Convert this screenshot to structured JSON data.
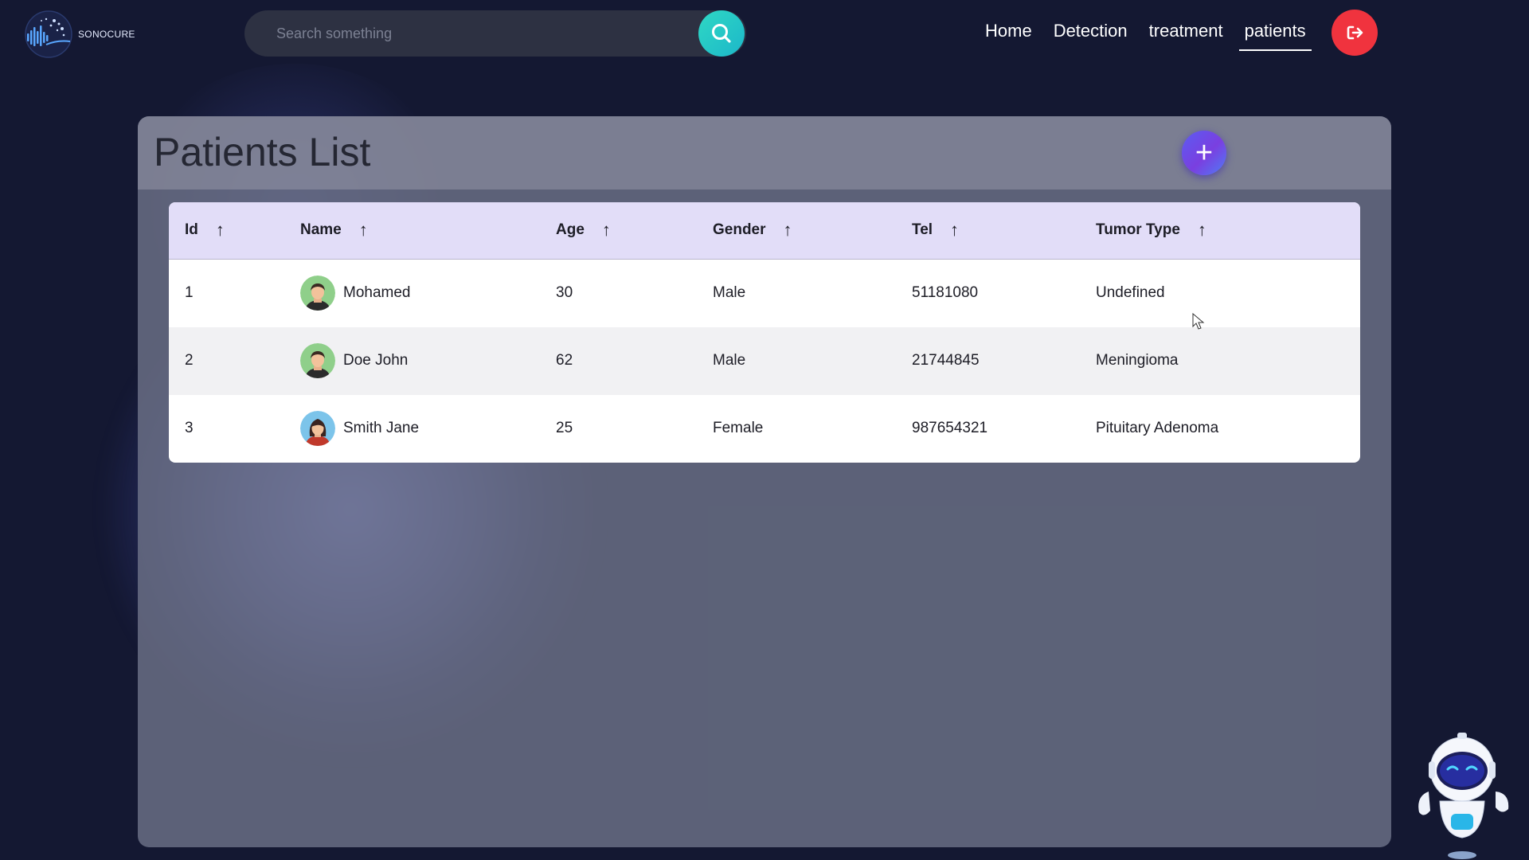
{
  "brand": {
    "name": "SONOCURE"
  },
  "search": {
    "placeholder": "Search something",
    "icon": "search-icon"
  },
  "nav": {
    "items": [
      {
        "label": "Home",
        "active": false
      },
      {
        "label": "Detection",
        "active": false
      },
      {
        "label": "treatment",
        "active": false
      },
      {
        "label": "patients",
        "active": true
      }
    ],
    "logout_icon": "logout-icon"
  },
  "page": {
    "title": "Patients List",
    "add_icon": "+"
  },
  "table": {
    "columns": [
      {
        "label": "Id",
        "sort": "↑"
      },
      {
        "label": "Name",
        "sort": "↑"
      },
      {
        "label": "Age",
        "sort": "↑"
      },
      {
        "label": "Gender",
        "sort": "↑"
      },
      {
        "label": "Tel",
        "sort": "↑"
      },
      {
        "label": "Tumor Type",
        "sort": "↑"
      }
    ],
    "rows": [
      {
        "id": "1",
        "name": "Mohamed",
        "age": "30",
        "gender": "Male",
        "tel": "51181080",
        "tumor_type": "Undefined",
        "avatar": "male-avatar"
      },
      {
        "id": "2",
        "name": "Doe John",
        "age": "62",
        "gender": "Male",
        "tel": "21744845",
        "tumor_type": "Meningioma",
        "avatar": "male-avatar"
      },
      {
        "id": "3",
        "name": "Smith Jane",
        "age": "25",
        "gender": "Female",
        "tel": "987654321",
        "tumor_type": "Pituitary Adenoma",
        "avatar": "female-avatar"
      }
    ]
  },
  "colors": {
    "background": "#141832",
    "search_button": "#2fd8c4",
    "logout_button": "#f0333e",
    "add_button": "#6a4bea",
    "table_header": "#e2ddf8"
  },
  "assistant": {
    "icon": "robot-assistant-icon"
  }
}
